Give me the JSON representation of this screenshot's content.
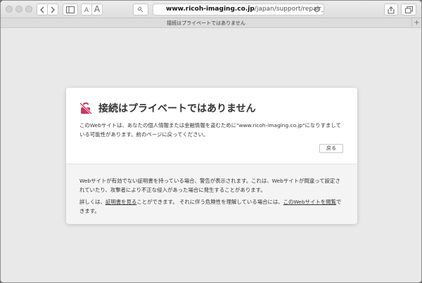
{
  "browser": {
    "url_host": "www.ricoh-imaging.co.jp",
    "url_path": "/japan/support/repair_entry-j.html",
    "tab_title": "接続はプライベートではありません",
    "font_small_label": "A",
    "font_large_label": "A",
    "new_tab_label": "+"
  },
  "error_page": {
    "title": "接続はプライベートではありません",
    "message": "このWebサイトは、あなたの個人情報または金融情報を盗むために\"www.ricoh-imaging.co.jp\"になりすましている可能性があります。前のページに戻ってください。",
    "back_button": "戻る",
    "details_text": "Webサイトが有効でない証明書を持っている場合、警告が表示されます。これは、Webサイトが間違って設定されていたり、攻撃者により不正な侵入があった場合に発生することがあります。",
    "details_prefix": "詳しくは、",
    "view_certificate_link": "証明書を見る",
    "details_middle": "ことができます。 それに伴う危険性を理解している場合には、",
    "visit_site_link": "このWebサイトを閲覧",
    "details_suffix": "できます。"
  },
  "colors": {
    "warning_icon": "#d2345f"
  }
}
